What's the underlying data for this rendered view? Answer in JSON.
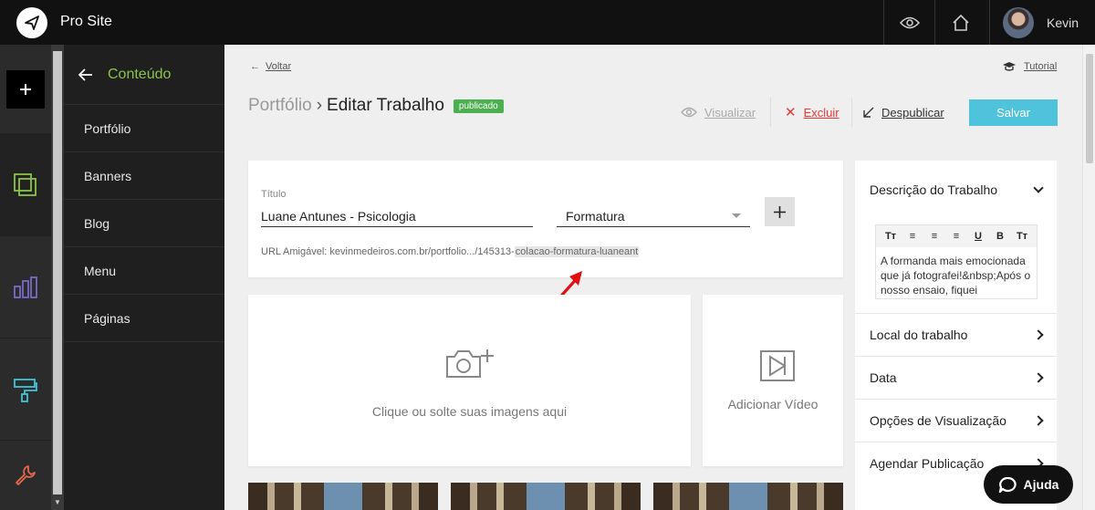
{
  "app": {
    "title": "Pro Site"
  },
  "topbar": {
    "user_name": "Kevin",
    "icons": [
      "eye-icon",
      "home-icon"
    ]
  },
  "rail": {
    "items": [
      "plus-icon",
      "layers-icon",
      "chart-icon",
      "paint-roller-icon",
      "wrench-icon"
    ]
  },
  "nav": {
    "title": "Conteúdo",
    "items": [
      {
        "label": "Portfólio"
      },
      {
        "label": "Banners"
      },
      {
        "label": "Blog"
      },
      {
        "label": "Menu"
      },
      {
        "label": "Páginas"
      }
    ]
  },
  "header": {
    "back_label": "Voltar",
    "tutorial_label": "Tutorial",
    "breadcrumb_parent": "Portfólio",
    "breadcrumb_sep": "›",
    "page_title": "Editar Trabalho",
    "status_badge": "publicado"
  },
  "actions": {
    "preview_label": "Visualizar",
    "delete_label": "Excluir",
    "unpublish_label": "Despublicar",
    "save_label": "Salvar"
  },
  "form": {
    "title_label": "Título",
    "title_value": "Luane Antunes - Psicologia",
    "category_value": "Formatura",
    "url_prefix": "URL Amigável: kevinmedeiros.com.br/portfolio.../145313-",
    "url_slug": "colacao-formatura-luaneant"
  },
  "media": {
    "drop_images_label": "Clique ou solte suas imagens aqui",
    "add_video_label": "Adicionar Vídeo"
  },
  "sidebar": {
    "description_title": "Descrição do Trabalho",
    "description_text": "A formanda mais emocionada que já fotografei!&nbsp;Após o nosso ensaio, fiquei",
    "toolbar": [
      "Tт",
      "≡",
      "≡",
      "≡",
      "U",
      "B",
      "Tт"
    ],
    "rows": [
      {
        "label": "Local do trabalho"
      },
      {
        "label": "Data"
      },
      {
        "label": "Opções de Visualização"
      },
      {
        "label": "Agendar Publicação"
      }
    ]
  },
  "help": {
    "label": "Ajuda"
  },
  "colors": {
    "accent": "#8bc34a",
    "save": "#4fc3dc",
    "badge": "#4caf50",
    "danger": "#e53935",
    "topbar": "#111111"
  }
}
